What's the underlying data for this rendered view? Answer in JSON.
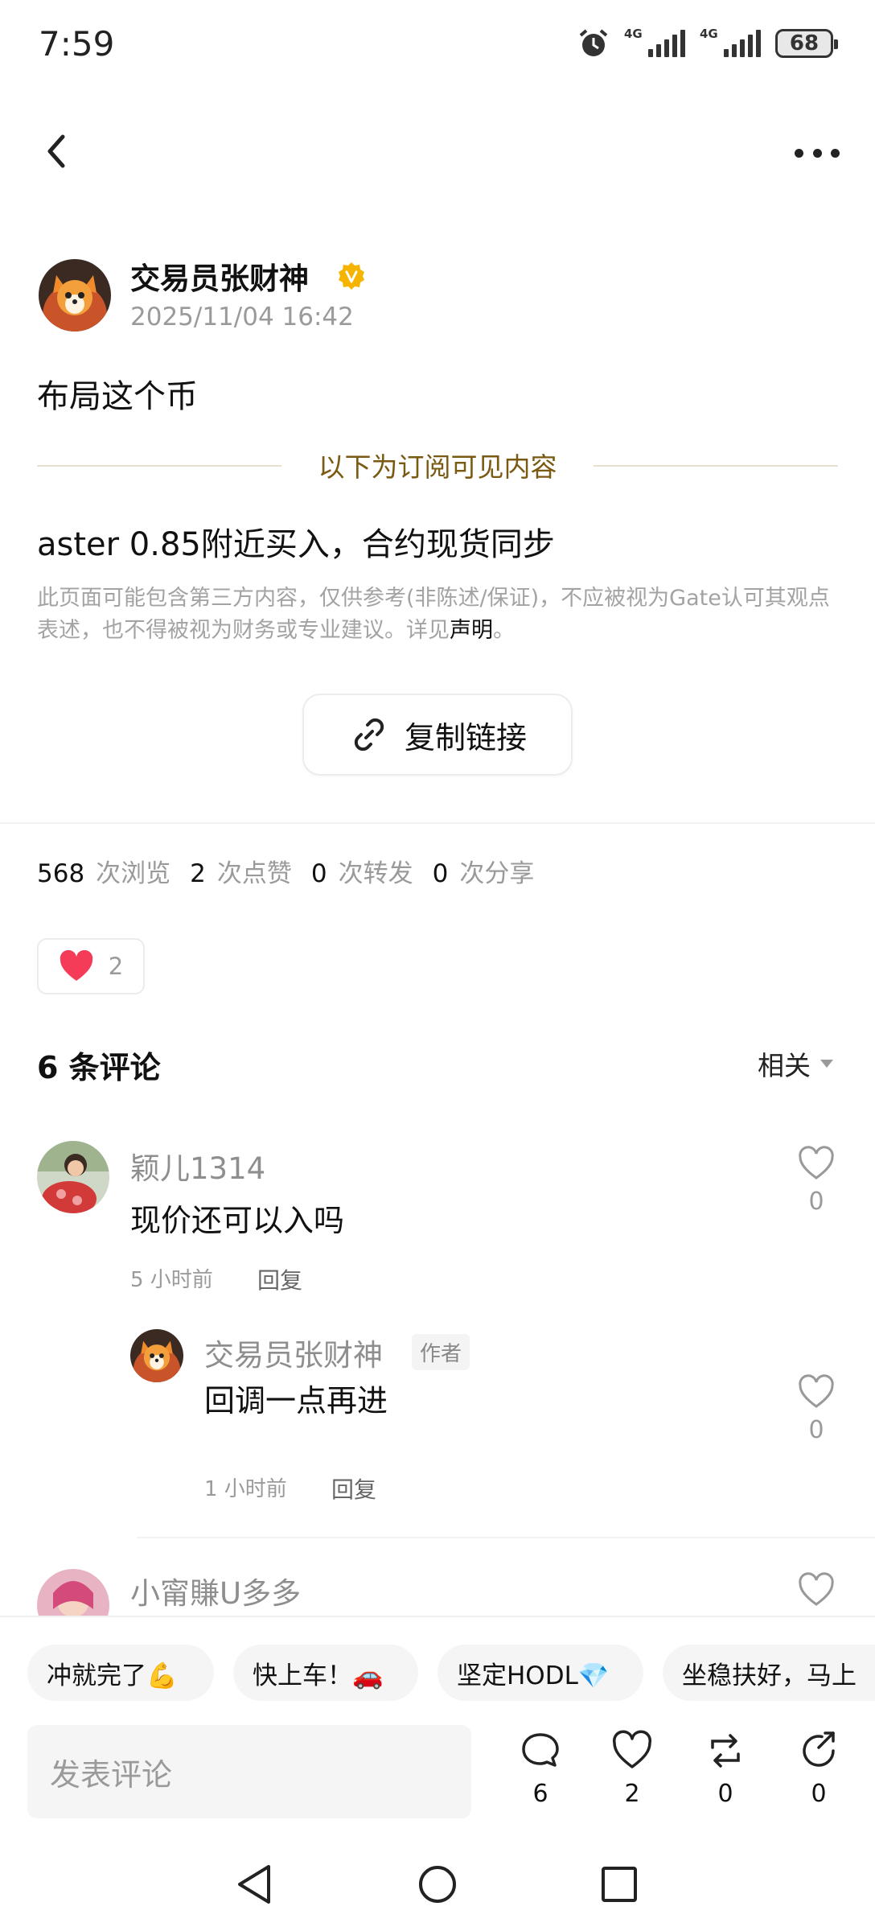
{
  "status_bar": {
    "time": "7:59",
    "network1": "4G",
    "network2": "4G",
    "battery": "68"
  },
  "post": {
    "author": "交易员张财神",
    "timestamp": "2025/11/04 16:42",
    "text": "布局这个币",
    "subscriber_divider": "以下为订阅可见内容",
    "premium_text": "aster  0.85附近买入，合约现货同步",
    "disclaimer": "此页面可能包含第三方内容，仅供参考(非陈述/保证)，不应被视为Gate认可其观点表述，也不得被视为财务或专业建议。详见",
    "disclaimer_link": "声明",
    "disclaimer_end": "。",
    "copy_link": "复制链接"
  },
  "stats": {
    "views": "568",
    "views_label": "次浏览",
    "likes": "2",
    "likes_label": "次点赞",
    "reposts": "0",
    "reposts_label": "次转发",
    "shares": "0",
    "shares_label": "次分享"
  },
  "reaction": {
    "count": "2"
  },
  "comments_header": {
    "title": "6 条评论",
    "sort": "相关"
  },
  "comments": [
    {
      "name": "颖儿1314",
      "text": "现价还可以入吗",
      "time": "5 小时前",
      "reply": "回复",
      "likes": "0"
    },
    {
      "name": "交易员张财神",
      "tag": "作者",
      "text": "回调一点再进",
      "time": "1 小时前",
      "reply": "回复",
      "likes": "0"
    },
    {
      "name": "小甯賺U多多"
    }
  ],
  "quick_replies": [
    "冲就完了💪",
    "快上车！🚗",
    "坚定HODL💎",
    "坐稳扶好，马上"
  ],
  "bottom_bar": {
    "input_placeholder": "发表评论",
    "comment_count": "6",
    "like_count": "2",
    "repost_count": "0",
    "share_count": "0"
  },
  "colors": {
    "accent_gold": "#7a5a12",
    "heart": "#f43b57",
    "verified": "#f5b400"
  }
}
